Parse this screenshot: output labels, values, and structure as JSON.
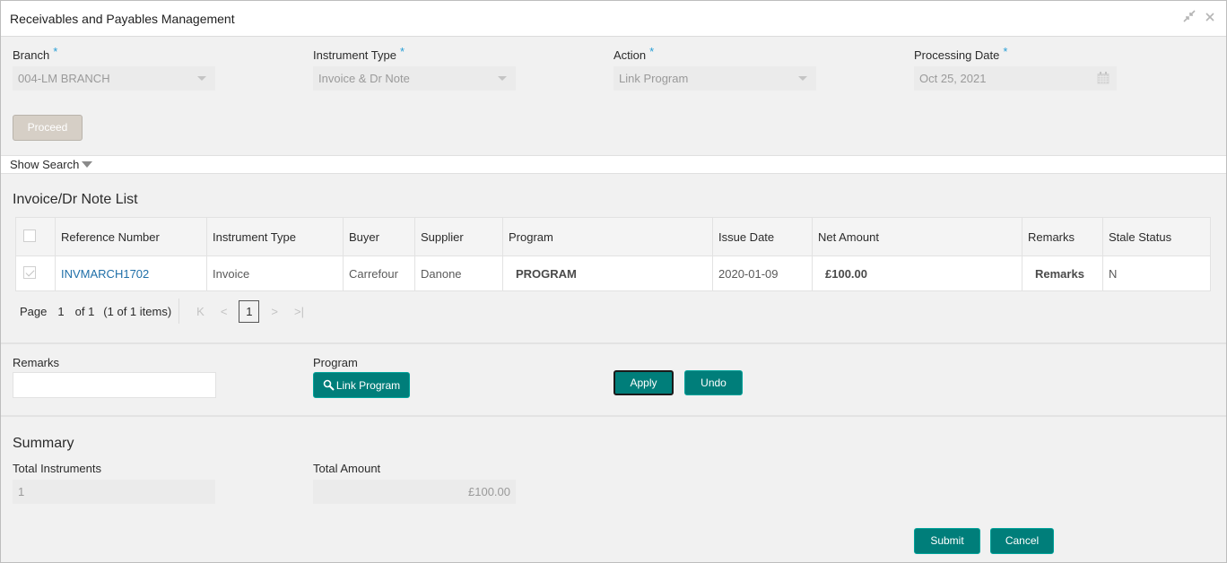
{
  "window": {
    "title": "Receivables and Payables Management",
    "icons": [
      "minimize-icon",
      "close-icon"
    ]
  },
  "form": {
    "branch": {
      "label": "Branch",
      "required": "*",
      "value": "004-LM BRANCH"
    },
    "instrument_type": {
      "label": "Instrument Type",
      "required": "*",
      "value": "Invoice & Dr Note"
    },
    "action": {
      "label": "Action",
      "required": "*",
      "value": "Link Program"
    },
    "processing_date": {
      "label": "Processing Date",
      "required": "*",
      "value": "Oct 25, 2021"
    },
    "proceed_label": "Proceed"
  },
  "show_search": {
    "label": "Show Search"
  },
  "list": {
    "title": "Invoice/Dr Note List",
    "columns": [
      "Reference Number",
      "Instrument Type",
      "Buyer",
      "Supplier",
      "Program",
      "Issue Date",
      "Net Amount",
      "Remarks",
      "Stale Status"
    ],
    "rows": [
      {
        "checked": true,
        "reference_number": "INVMARCH1702",
        "instrument_type": "Invoice",
        "buyer": "Carrefour",
        "supplier": "Danone",
        "program": "PROGRAM",
        "issue_date": "2020-01-09",
        "net_amount": "£100.00",
        "remarks": "Remarks",
        "stale_status": "N"
      }
    ],
    "pager": {
      "page_label": "Page",
      "current_page": "1",
      "of_label": "of 1",
      "items_label": "(1 of 1 items)",
      "page_button": "1"
    }
  },
  "bulk": {
    "remarks_label": "Remarks",
    "remarks_value": "",
    "program_label": "Program",
    "link_program_label": "Link Program",
    "apply_label": "Apply",
    "undo_label": "Undo"
  },
  "summary": {
    "title": "Summary",
    "total_instruments_label": "Total Instruments",
    "total_instruments_value": "1",
    "total_amount_label": "Total Amount",
    "total_amount_value": "£100.00"
  },
  "footer": {
    "submit_label": "Submit",
    "cancel_label": "Cancel"
  },
  "colors": {
    "accent": "#007e7a",
    "link": "#1f6fa8",
    "required": "#2a9fd6"
  }
}
